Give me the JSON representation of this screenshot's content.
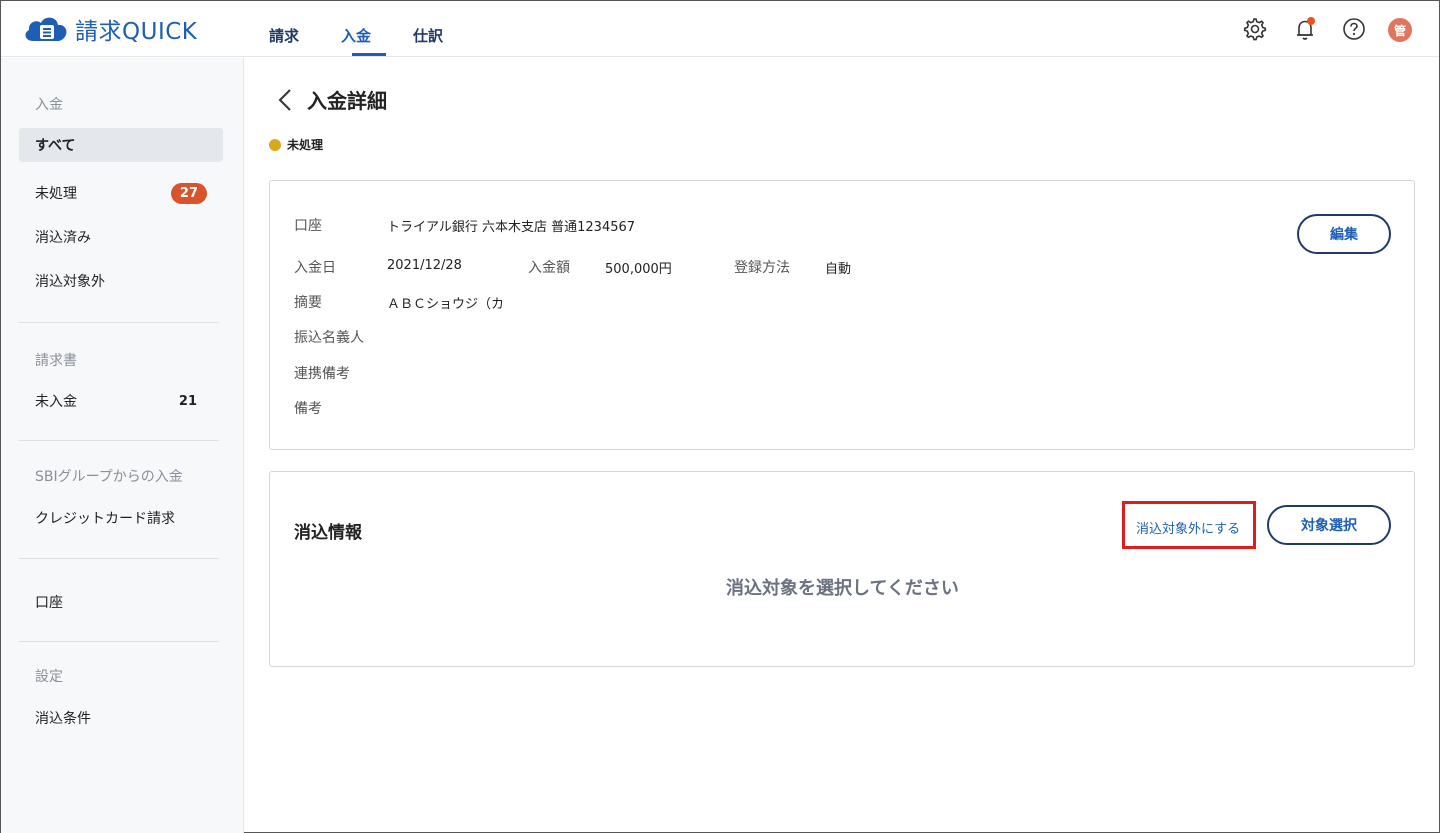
{
  "header": {
    "logo_text": "請求QUICK",
    "nav": [
      {
        "label": "請求"
      },
      {
        "label": "入金"
      },
      {
        "label": "仕訳"
      }
    ],
    "avatar_text": "管",
    "icons": [
      "gear-icon",
      "bell-icon",
      "help-icon"
    ],
    "notification_color": "#e8551f"
  },
  "sidebar": {
    "sections": {
      "payment": "入金",
      "invoice": "請求書",
      "sbi": "SBIグループからの入金",
      "settings": "設定"
    },
    "items": {
      "all": "すべて",
      "unprocessed": "未処理",
      "unprocessed_count": "27",
      "reconciled": "消込済み",
      "excluded": "消込対象外",
      "unpaid": "未入金",
      "unpaid_count": "21",
      "credit_card": "クレジットカード請求",
      "account": "口座",
      "reconcile_rules": "消込条件"
    }
  },
  "main": {
    "title": "入金詳細",
    "status": "未処理",
    "status_color": "#d9a81d",
    "detail": {
      "account_label": "口座",
      "account_value": "トライアル銀行 六本木支店 普通1234567",
      "date_label": "入金日",
      "date_value": "2021/12/28",
      "amount_label": "入金額",
      "amount_value": "500,000円",
      "method_label": "登録方法",
      "method_value": "自動",
      "summary_label": "摘要",
      "summary_value": "ＡＢＣショウジ（カ",
      "payer_label": "振込名義人",
      "note_link_label": "連携備考",
      "note_label": "備考",
      "edit_button": "編集"
    },
    "reconcile": {
      "title": "消込情報",
      "exclude_link": "消込対象外にする",
      "select_button": "対象選択",
      "empty_message": "消込対象を選択してください"
    }
  },
  "colors": {
    "brand": "#1e5fb3",
    "highlight": "#e01b1b",
    "badge": "#d9532c"
  }
}
